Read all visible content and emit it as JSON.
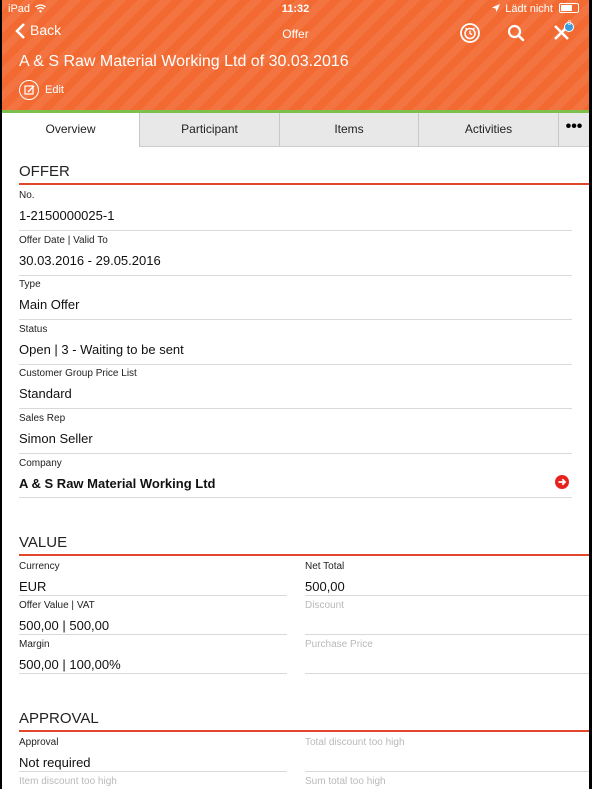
{
  "status_bar": {
    "carrier": "iPad",
    "time": "11:32",
    "right_text": "Lädt nicht"
  },
  "nav": {
    "back_label": "Back",
    "title": "Offer",
    "cart_badge": "0"
  },
  "record": {
    "title": "A & S Raw Material Working Ltd of 30.03.2016",
    "edit_label": "Edit"
  },
  "tabs": [
    {
      "label": "Overview",
      "active": true
    },
    {
      "label": "Participant"
    },
    {
      "label": "Items"
    },
    {
      "label": "Activities"
    }
  ],
  "more_label": "•••",
  "offer": {
    "header": "OFFER",
    "fields": [
      {
        "label": "No.",
        "value": "1-2150000025-1"
      },
      {
        "label": "Offer Date | Valid To",
        "value": "30.03.2016 - 29.05.2016"
      },
      {
        "label": "Type",
        "value": "Main Offer"
      },
      {
        "label": "Status",
        "value": "Open | 3 - Waiting to be sent"
      },
      {
        "label": "Customer Group Price List",
        "value": "Standard"
      },
      {
        "label": "Sales Rep",
        "value": "Simon Seller"
      },
      {
        "label": "Company",
        "value": "A & S Raw Material Working Ltd"
      }
    ]
  },
  "value": {
    "header": "VALUE",
    "left": [
      {
        "label": "Currency",
        "value": "EUR"
      },
      {
        "label": "Offer Value | VAT",
        "value": "500,00 | 500,00"
      },
      {
        "label": "Margin",
        "value": "500,00 | 100,00%"
      }
    ],
    "right": [
      {
        "label": "Net Total",
        "value": "500,00"
      },
      {
        "label": "Discount",
        "value": ""
      },
      {
        "label": "Purchase Price",
        "value": ""
      }
    ]
  },
  "approval": {
    "header": "APPROVAL",
    "left": [
      {
        "label": "Approval",
        "value": "Not required"
      },
      {
        "label": "Item discount too high",
        "value": ""
      }
    ],
    "right": [
      {
        "label": "Total discount too high",
        "value": ""
      },
      {
        "label": "Sum total too high",
        "value": ""
      }
    ]
  },
  "colors": {
    "brand_orange": "#f26a32",
    "accent_red": "#e0472a",
    "green_line": "#7cc04b"
  }
}
